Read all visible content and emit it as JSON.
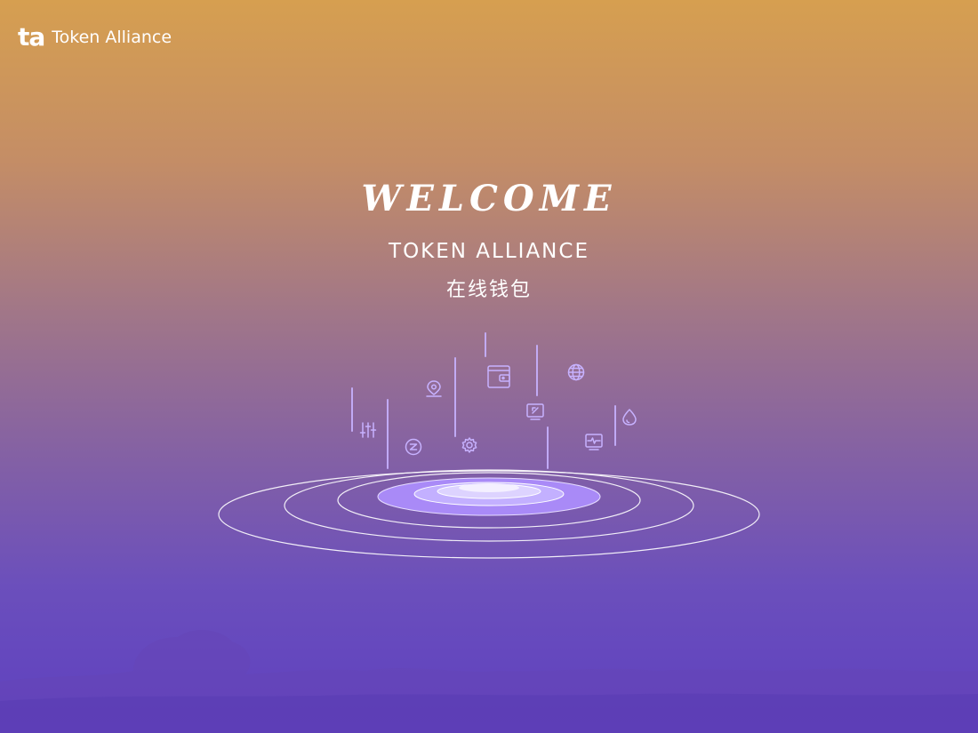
{
  "header": {
    "logo_mark": "ta",
    "brand_name": "Token Alliance"
  },
  "hero": {
    "welcome": "WELCOME",
    "subtitle": "TOKEN ALLIANCE",
    "subtitle_cn": "在线钱包"
  },
  "illustration": {
    "icons": [
      "location-pin-icon",
      "wallet-icon",
      "globe-icon",
      "upload-screen-icon",
      "water-drop-icon",
      "sliders-icon",
      "no-entry-icon",
      "gear-icon",
      "monitor-pulse-icon"
    ]
  },
  "colors": {
    "gradient_top": "#d69f50",
    "gradient_bottom": "#5e40c0",
    "accent": "#b39cff",
    "ring": "#ffffff"
  }
}
